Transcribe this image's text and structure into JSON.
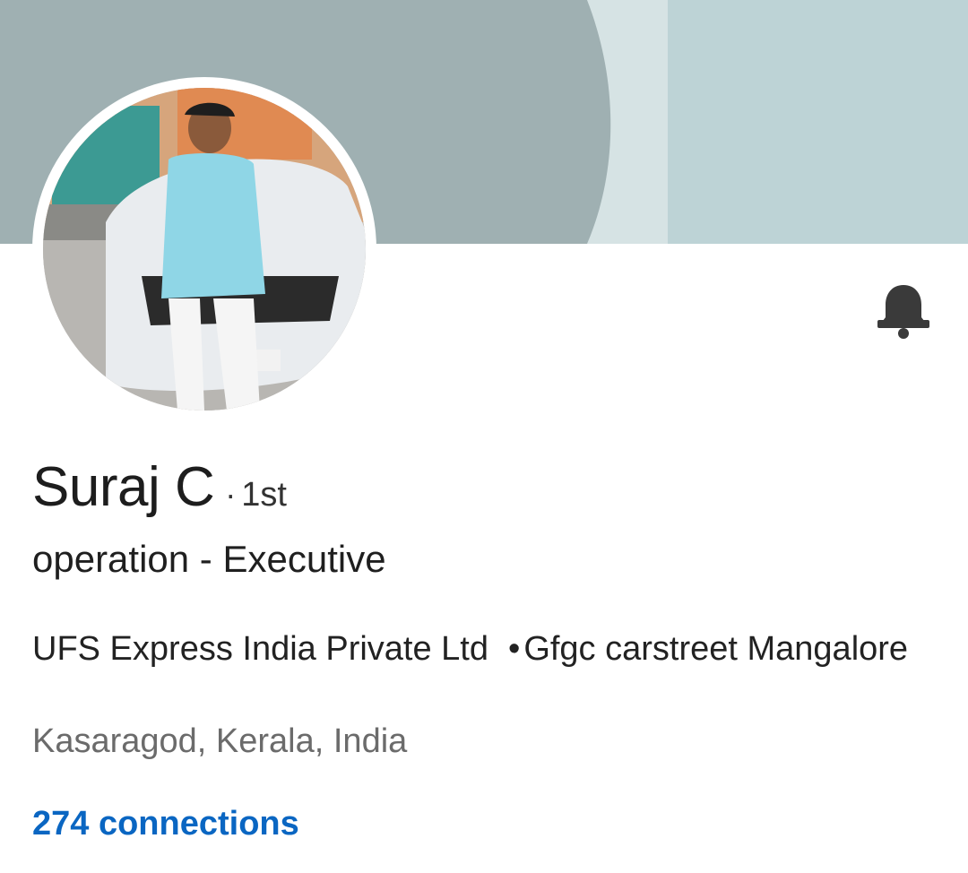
{
  "profile": {
    "name": "Suraj C",
    "degree_separator": "·",
    "degree": "1st",
    "headline": "operation - Executive",
    "company": "UFS Express India Private Ltd",
    "education_separator": "•",
    "education": "Gfgc carstreet Mangalore",
    "location": "Kasaragod, Kerala, India",
    "connections": "274 connections"
  },
  "icons": {
    "notification": "bell-icon"
  },
  "colors": {
    "banner_dark": "#9fb0b2",
    "banner_light": "#bcd1d4",
    "link": "#0a66c2",
    "icon": "#3a3a3a"
  }
}
